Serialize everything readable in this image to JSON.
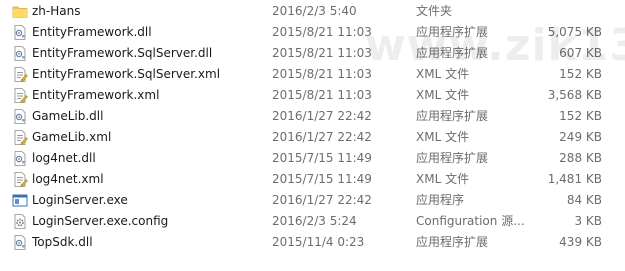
{
  "watermark": "www.zik1314.com",
  "files": [
    {
      "icon": "folder-icon",
      "name": "zh-Hans",
      "date": "2016/2/3 5:40",
      "type": "文件夹",
      "size": ""
    },
    {
      "icon": "dll-file-icon",
      "name": "EntityFramework.dll",
      "date": "2015/8/21 11:03",
      "type": "应用程序扩展",
      "size": "5,075 KB"
    },
    {
      "icon": "dll-file-icon",
      "name": "EntityFramework.SqlServer.dll",
      "date": "2015/8/21 11:03",
      "type": "应用程序扩展",
      "size": "607 KB"
    },
    {
      "icon": "xml-file-icon",
      "name": "EntityFramework.SqlServer.xml",
      "date": "2015/8/21 11:03",
      "type": "XML 文件",
      "size": "152 KB"
    },
    {
      "icon": "xml-file-icon",
      "name": "EntityFramework.xml",
      "date": "2015/8/21 11:03",
      "type": "XML 文件",
      "size": "3,568 KB"
    },
    {
      "icon": "dll-file-icon",
      "name": "GameLib.dll",
      "date": "2016/1/27 22:42",
      "type": "应用程序扩展",
      "size": "152 KB"
    },
    {
      "icon": "xml-file-icon",
      "name": "GameLib.xml",
      "date": "2016/1/27 22:42",
      "type": "XML 文件",
      "size": "249 KB"
    },
    {
      "icon": "dll-file-icon",
      "name": "log4net.dll",
      "date": "2015/7/15 11:49",
      "type": "应用程序扩展",
      "size": "288 KB"
    },
    {
      "icon": "xml-file-icon",
      "name": "log4net.xml",
      "date": "2015/7/15 11:49",
      "type": "XML 文件",
      "size": "1,481 KB"
    },
    {
      "icon": "exe-file-icon",
      "name": "LoginServer.exe",
      "date": "2016/1/27 22:42",
      "type": "应用程序",
      "size": "84 KB"
    },
    {
      "icon": "config-file-icon",
      "name": "LoginServer.exe.config",
      "date": "2016/2/3 5:24",
      "type": "Configuration 源...",
      "size": "3 KB"
    },
    {
      "icon": "dll-file-icon",
      "name": "TopSdk.dll",
      "date": "2015/11/4 0:23",
      "type": "应用程序扩展",
      "size": "439 KB"
    }
  ]
}
